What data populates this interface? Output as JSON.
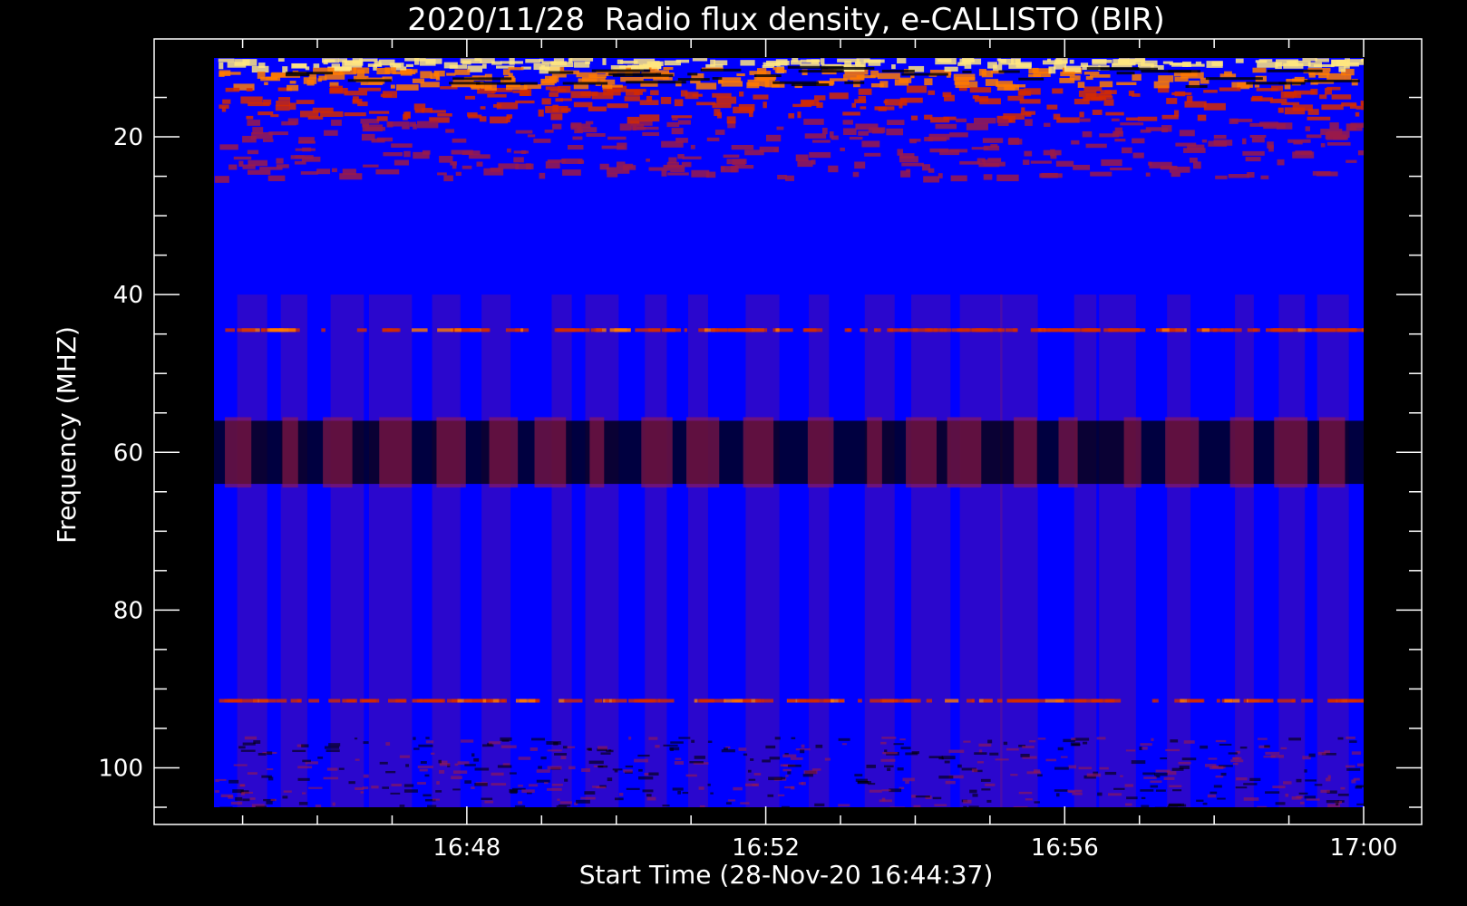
{
  "chart_data": {
    "type": "heatmap",
    "title": "2020/11/28  Radio flux density, e-CALLISTO (BIR)",
    "xlabel": "Start Time (28-Nov-20 16:44:37)",
    "ylabel": "Frequency (MHZ)",
    "x_axis": {
      "range": [
        "16:44:37",
        "17:00:00"
      ],
      "major_ticks": [
        "16:48",
        "16:52",
        "16:56",
        "17:00"
      ],
      "minor_tick_interval_minutes": 1
    },
    "y_axis": {
      "range_mhz": [
        10,
        105
      ],
      "inverted": true,
      "major_ticks": [
        20,
        40,
        60,
        80,
        100
      ],
      "minor_tick_interval_mhz": 5
    },
    "colormap": [
      "#000000",
      "#0000ff",
      "#9a1a4a",
      "#d42a00",
      "#ff7a00",
      "#ffe680"
    ],
    "background_color": "#0000ff",
    "features": [
      {
        "kind": "rfi_band",
        "freq_mhz": [
          10,
          25
        ],
        "intensity": "high"
      },
      {
        "kind": "rfi_line",
        "freq_mhz": 44.5,
        "intensity": "medium"
      },
      {
        "kind": "dark_band",
        "freq_mhz": [
          56,
          64
        ]
      },
      {
        "kind": "rfi_line",
        "freq_mhz": 91.5,
        "intensity": "medium"
      },
      {
        "kind": "rfi_band",
        "freq_mhz": [
          96,
          105
        ],
        "intensity": "low"
      },
      {
        "kind": "vertical_stripes",
        "freq_mhz": [
          40,
          105
        ]
      }
    ],
    "grid": false,
    "legend": "none"
  }
}
